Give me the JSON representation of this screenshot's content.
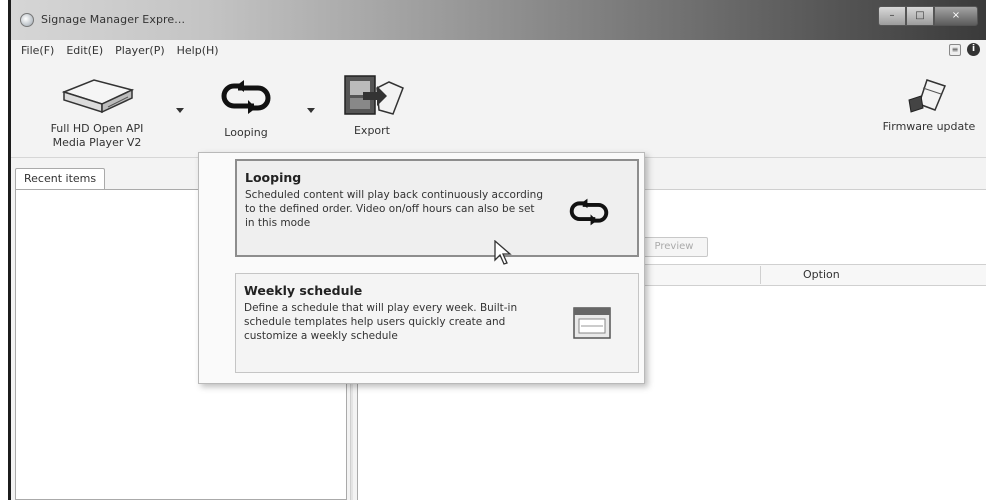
{
  "window": {
    "title": "Signage Manager Expre..."
  },
  "menu": {
    "items": [
      {
        "label": "File(F)"
      },
      {
        "label": "Edit(E)"
      },
      {
        "label": "Player(P)"
      },
      {
        "label": "Help(H)"
      }
    ]
  },
  "toolbar": {
    "player_label_line1": "Full HD Open API",
    "player_label_line2": "Media Player V2",
    "looping_label": "Looping",
    "export_label": "Export",
    "firmware_label": "Firmware update"
  },
  "left_panel": {
    "tab_label": "Recent items"
  },
  "right_panel": {
    "preview_label": "Preview",
    "column_option": "Option"
  },
  "dropdown": {
    "options": [
      {
        "title": "Looping",
        "description": "Scheduled content will play back continuously according to the defined order. Video on/off hours can also be set in this mode",
        "icon": "loop-icon"
      },
      {
        "title": "Weekly schedule",
        "description": "Define a schedule that will play every week. Built-in schedule templates help users quickly create and customize a weekly schedule",
        "icon": "calendar-icon"
      }
    ]
  }
}
